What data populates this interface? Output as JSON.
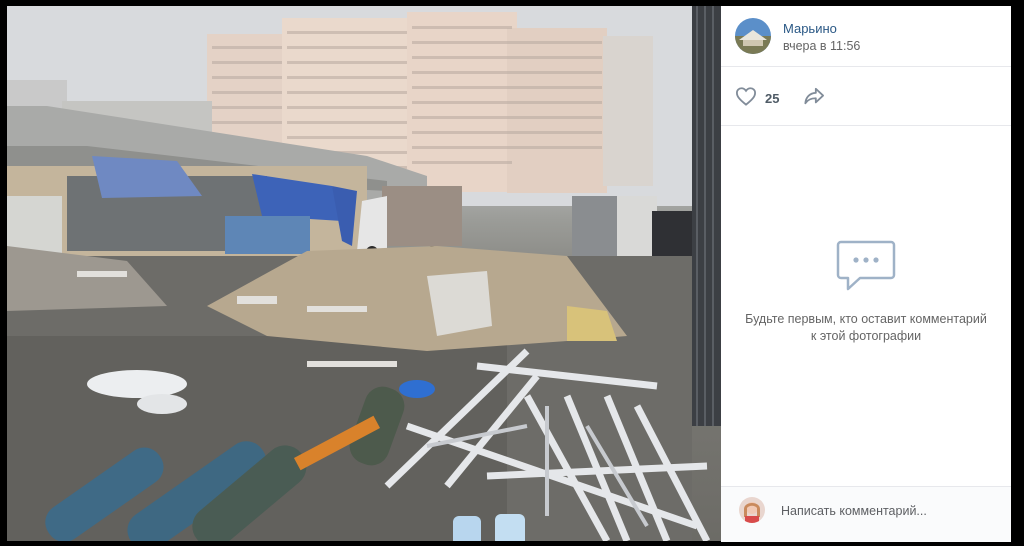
{
  "viewer": {
    "photo_alt": "Фотография"
  },
  "post": {
    "author": "Марьино",
    "time": "вчера в 11:56"
  },
  "actions": {
    "likes": "25",
    "like_icon": "heart-icon",
    "share_icon": "share-arrow-icon"
  },
  "comments": {
    "empty_icon": "comment-bubble-icon",
    "empty_text": "Будьте первым, кто оставит комментарий к этой фотографии",
    "placeholder": "Написать комментарий..."
  },
  "colors": {
    "link": "#2a5885",
    "muted": "#656565",
    "divider": "#e7e8ec",
    "icon": "#818c99"
  }
}
